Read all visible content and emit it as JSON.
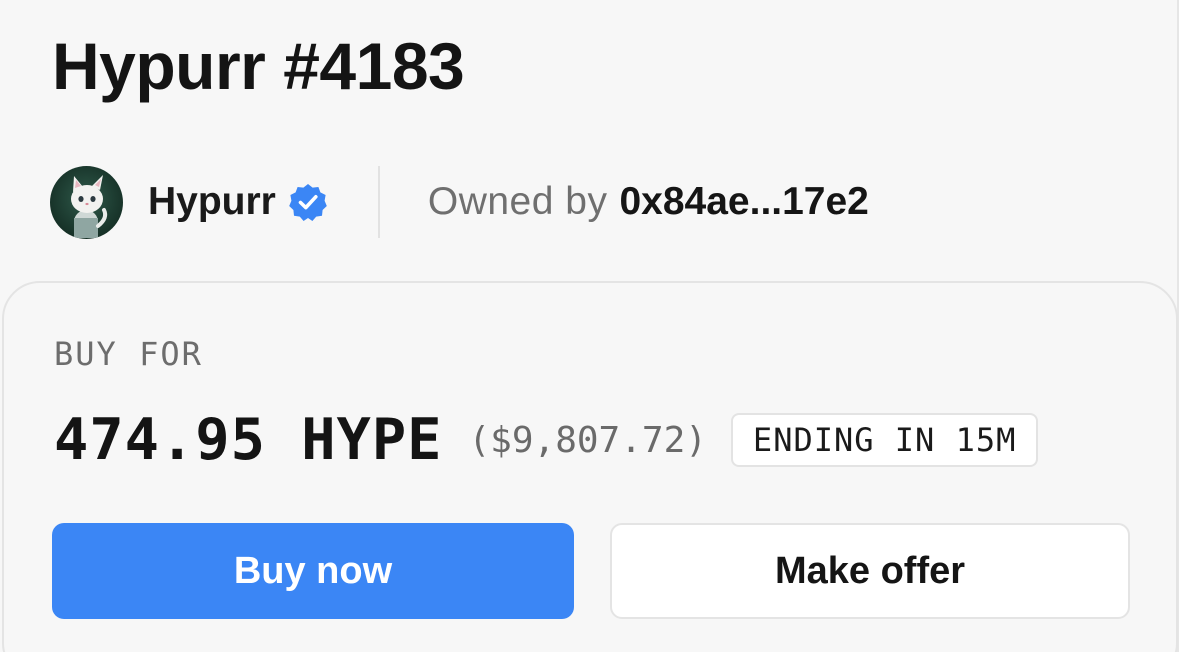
{
  "header": {
    "title": "Hypurr #4183"
  },
  "collection": {
    "name": "Hypurr",
    "verified": true,
    "avatar_icon": "cat-avatar-icon",
    "verified_icon": "verified-badge-icon"
  },
  "owner": {
    "label": "Owned by",
    "address": "0x84ae...17e2"
  },
  "buy": {
    "label": "BUY FOR",
    "price": "474.95 HYPE",
    "usd": "($9,807.72)",
    "ending": "ENDING IN 15M",
    "buy_now_label": "Buy now",
    "make_offer_label": "Make offer"
  },
  "colors": {
    "accent": "#3b86f5",
    "verified": "#3b86f5",
    "background": "#f7f7f7"
  }
}
